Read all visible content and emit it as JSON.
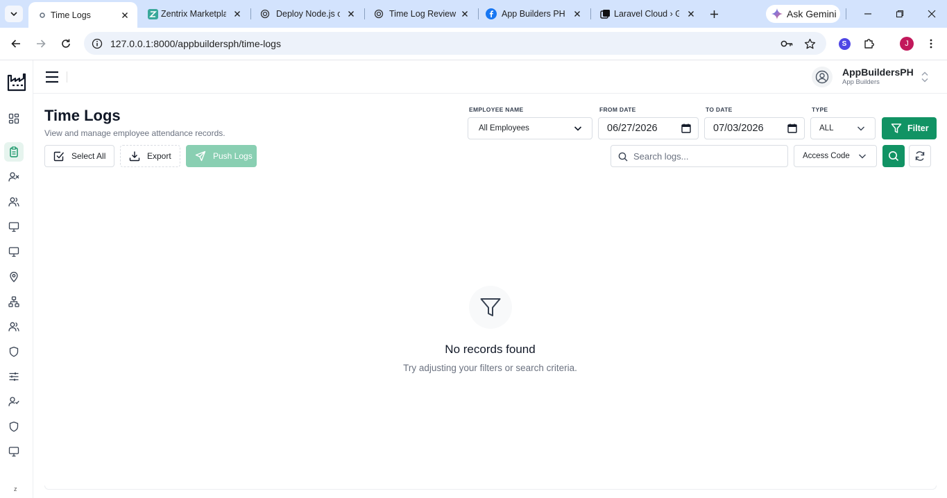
{
  "browser": {
    "tabs": [
      {
        "title": "Time Logs",
        "active": true
      },
      {
        "title": "Zentrix Marketplace",
        "active": false
      },
      {
        "title": "Deploy Node.js on",
        "active": false
      },
      {
        "title": "Time Log Review",
        "active": false
      },
      {
        "title": "App Builders PH",
        "active": false
      },
      {
        "title": "Laravel Cloud › Ge",
        "active": false
      }
    ],
    "ask_gemini_label": "Ask Gemini",
    "url": "127.0.0.1:8000/appbuildersph/time-logs",
    "profile_extension_letter": "S",
    "profile_letter": "J"
  },
  "org": {
    "name": "AppBuildersPH",
    "subtitle": "App Builders"
  },
  "sidebar": {
    "items": [
      {
        "icon": "dashboard-icon",
        "active": false
      },
      {
        "icon": "clipboard-icon",
        "active": true
      },
      {
        "icon": "user-x-icon",
        "active": false
      },
      {
        "icon": "users-icon",
        "active": false
      },
      {
        "icon": "monitor-icon",
        "active": false
      },
      {
        "icon": "monitor-icon",
        "active": false
      },
      {
        "icon": "map-pin-icon",
        "active": false
      },
      {
        "icon": "network-icon",
        "active": false
      },
      {
        "icon": "users-icon",
        "active": false
      },
      {
        "icon": "shield-icon",
        "active": false
      },
      {
        "icon": "sliders-icon",
        "active": false
      },
      {
        "icon": "user-check-icon",
        "active": false
      },
      {
        "icon": "shield-icon",
        "active": false
      },
      {
        "icon": "monitor-icon",
        "active": false
      }
    ],
    "footer_letter": "z"
  },
  "page": {
    "title": "Time Logs",
    "subtitle": "View and manage employee attendance records."
  },
  "actions": {
    "select_all": "Select All",
    "export": "Export",
    "push_logs": "Push Logs"
  },
  "filters": {
    "employee_label": "EMPLOYEE NAME",
    "employee_value": "All Employees",
    "from_label": "FROM DATE",
    "from_value": "06/27/2026",
    "to_label": "TO DATE",
    "to_value": "07/03/2026",
    "type_label": "TYPE",
    "type_value": "ALL",
    "filter_button": "Filter",
    "search_placeholder": "Search logs...",
    "search_field_value": "Access Code"
  },
  "empty_state": {
    "title": "No records found",
    "subtitle": "Try adjusting your filters or search criteria."
  },
  "colors": {
    "primary": "#119364",
    "primary_soft": "#89cfb2",
    "active_nav_bg": "#e6f4ee",
    "chrome_tabstrip": "#d3e3fd"
  }
}
